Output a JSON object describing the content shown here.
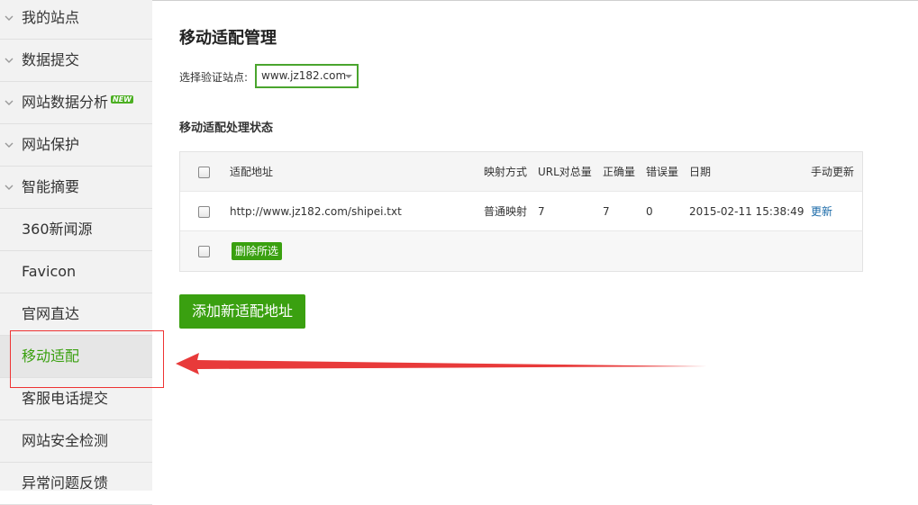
{
  "sidebar": {
    "items": [
      {
        "label": "我的站点",
        "has_chevron": true
      },
      {
        "label": "数据提交",
        "has_chevron": true
      },
      {
        "label": "网站数据分析",
        "has_chevron": true,
        "badge": "NEW"
      },
      {
        "label": "网站保护",
        "has_chevron": true
      },
      {
        "label": "智能摘要",
        "has_chevron": true
      },
      {
        "label": "360新闻源",
        "has_chevron": false
      },
      {
        "label": "Favicon",
        "has_chevron": false
      },
      {
        "label": "官网直达",
        "has_chevron": false
      },
      {
        "label": "移动适配",
        "has_chevron": false,
        "active": true
      },
      {
        "label": "客服电话提交",
        "has_chevron": false
      },
      {
        "label": "网站安全检测",
        "has_chevron": false
      },
      {
        "label": "异常问题反馈",
        "has_chevron": false
      }
    ]
  },
  "main": {
    "title": "移动适配管理",
    "site_label": "选择验证站点:",
    "site_value": "www.jz182.com",
    "section_title": "移动适配处理状态",
    "table": {
      "headers": [
        "适配地址",
        "映射方式",
        "URL对总量",
        "正确量",
        "错误量",
        "日期",
        "手动更新"
      ],
      "rows": [
        [
          "http://www.jz182.com/shipei.txt",
          "普通映射",
          "7",
          "7",
          "0",
          "2015-02-11 15:38:49",
          "更新"
        ]
      ],
      "delete_selected": "删除所选"
    },
    "add_button": "添加新适配地址"
  },
  "colors": {
    "accent_green": "#3aa010",
    "highlight_red": "#e33333",
    "link_blue": "#1a6aa8"
  }
}
